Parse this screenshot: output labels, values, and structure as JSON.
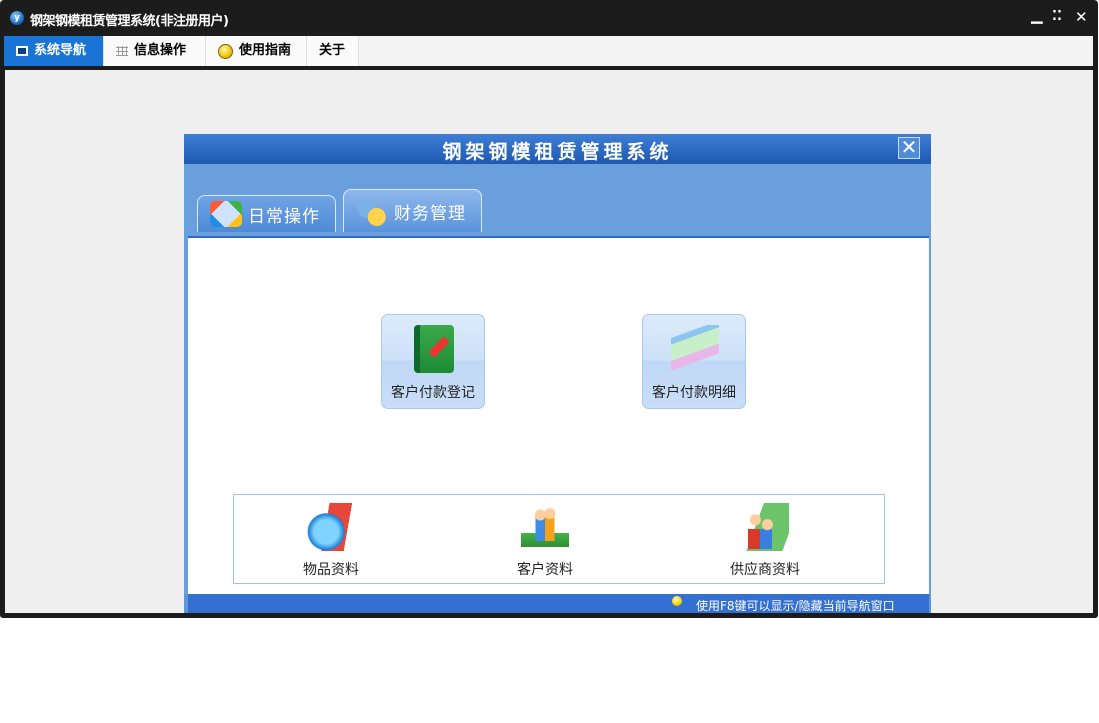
{
  "window": {
    "title": "钢架钢模租赁管理系统(非注册用户)",
    "app_icon_letter": "y",
    "controls": {
      "minimize": "▁",
      "restore": "⁚⁚",
      "close": "✕"
    }
  },
  "menu": {
    "tabs": [
      {
        "label": "系统导航",
        "icon": "monitor-icon",
        "active": true
      },
      {
        "label": "信息操作",
        "icon": "grid-icon",
        "active": false
      },
      {
        "label": "使用指南",
        "icon": "bulb-icon",
        "active": false
      },
      {
        "label": "关于",
        "icon": "",
        "active": false
      }
    ]
  },
  "dialog": {
    "title": "钢架钢模租赁管理系统",
    "close_symbol": "✕",
    "tabs": [
      {
        "label": "日常操作",
        "icon": "windows-icon",
        "active": false
      },
      {
        "label": "财务管理",
        "icon": "money-icon",
        "active": true
      }
    ],
    "buttons": [
      {
        "label": "客户付款登记",
        "icon": "notebook-pencil-icon"
      },
      {
        "label": "客户付款明细",
        "icon": "papers-icon"
      }
    ],
    "quick_links": [
      {
        "label": "物品资料",
        "icon": "globe-folder-icon"
      },
      {
        "label": "客户资料",
        "icon": "people-book-icon"
      },
      {
        "label": "供应商资料",
        "icon": "people-folder-icon"
      }
    ],
    "status_text": "使用F8键可以显示/隐藏当前导航窗口"
  },
  "colors": {
    "window_frame": "#1c1c1c",
    "active_tab": "#1a74d6",
    "dialog_blue": "#5f97d9",
    "status_blue": "#3470d2"
  }
}
